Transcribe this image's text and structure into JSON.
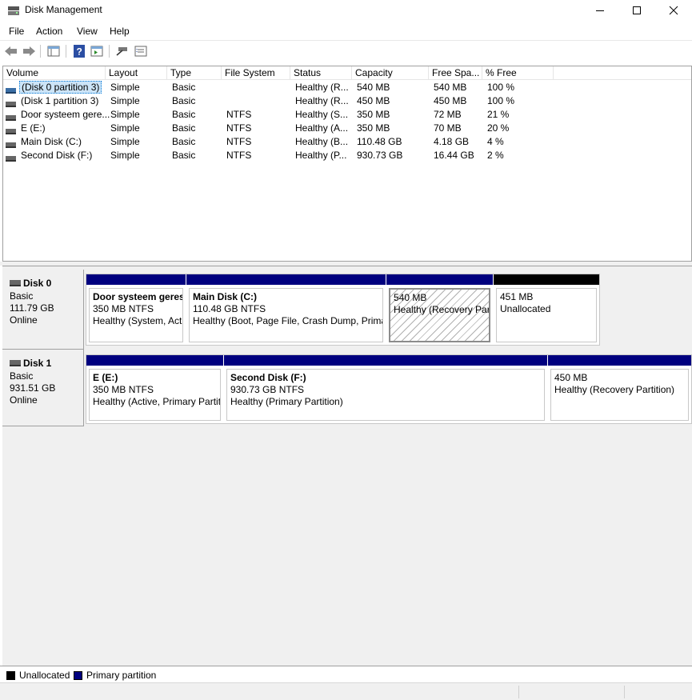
{
  "window": {
    "title": "Disk Management"
  },
  "menu": [
    {
      "label": "File"
    },
    {
      "label": "Action"
    },
    {
      "label": "View"
    },
    {
      "label": "Help"
    }
  ],
  "volume_table": {
    "columns": [
      "Volume",
      "Layout",
      "Type",
      "File System",
      "Status",
      "Capacity",
      "Free Spa...",
      "% Free"
    ],
    "rows": [
      {
        "volume": "(Disk 0 partition 3)",
        "layout": "Simple",
        "type": "Basic",
        "fs": "",
        "status": "Healthy (R...",
        "capacity": "540 MB",
        "free": "540 MB",
        "pct": "100 %",
        "selected": true
      },
      {
        "volume": "(Disk 1 partition 3)",
        "layout": "Simple",
        "type": "Basic",
        "fs": "",
        "status": "Healthy (R...",
        "capacity": "450 MB",
        "free": "450 MB",
        "pct": "100 %"
      },
      {
        "volume": "Door systeem gere...",
        "layout": "Simple",
        "type": "Basic",
        "fs": "NTFS",
        "status": "Healthy (S...",
        "capacity": "350 MB",
        "free": "72 MB",
        "pct": "21 %"
      },
      {
        "volume": "E (E:)",
        "layout": "Simple",
        "type": "Basic",
        "fs": "NTFS",
        "status": "Healthy (A...",
        "capacity": "350 MB",
        "free": "70 MB",
        "pct": "20 %"
      },
      {
        "volume": "Main Disk (C:)",
        "layout": "Simple",
        "type": "Basic",
        "fs": "NTFS",
        "status": "Healthy (B...",
        "capacity": "110.48 GB",
        "free": "4.18 GB",
        "pct": "4 %"
      },
      {
        "volume": "Second Disk (F:)",
        "layout": "Simple",
        "type": "Basic",
        "fs": "NTFS",
        "status": "Healthy (P...",
        "capacity": "930.73 GB",
        "free": "16.44 GB",
        "pct": "2 %"
      }
    ]
  },
  "disks": [
    {
      "name": "Disk 0",
      "type": "Basic",
      "size": "111.79 GB",
      "state": "Online",
      "partitions": [
        {
          "title": "Door systeem geresei",
          "size_fs": "350 MB NTFS",
          "status": "Healthy (System, Acti",
          "bar": "primary"
        },
        {
          "title": "Main Disk  (C:)",
          "size_fs": "110.48 GB NTFS",
          "status": "Healthy (Boot, Page File, Crash Dump, Prima",
          "bar": "primary"
        },
        {
          "title": "",
          "size_fs": "540 MB",
          "status": "Healthy (Recovery Parti",
          "bar": "primary",
          "hatched": true
        },
        {
          "title": "",
          "size_fs": "451 MB",
          "status": "Unallocated",
          "bar": "unallocated"
        }
      ]
    },
    {
      "name": "Disk 1",
      "type": "Basic",
      "size": "931.51 GB",
      "state": "Online",
      "partitions": [
        {
          "title": "E  (E:)",
          "size_fs": "350 MB NTFS",
          "status": "Healthy (Active, Primary Partiti",
          "bar": "primary"
        },
        {
          "title": "Second Disk  (F:)",
          "size_fs": "930.73 GB NTFS",
          "status": "Healthy (Primary Partition)",
          "bar": "primary"
        },
        {
          "title": "",
          "size_fs": "450 MB",
          "status": "Healthy (Recovery Partition)",
          "bar": "primary"
        }
      ]
    }
  ],
  "legend": [
    {
      "label": "Unallocated",
      "color": "#000000"
    },
    {
      "label": "Primary partition",
      "color": "#00007f"
    }
  ]
}
